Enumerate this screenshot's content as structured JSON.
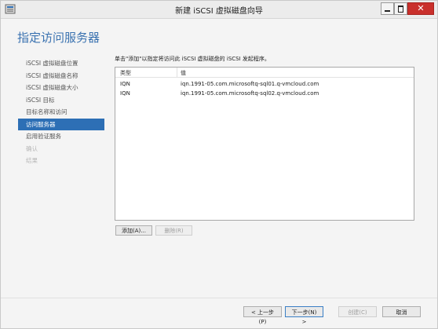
{
  "window": {
    "title": "新建 iSCSI 虚拟磁盘向导",
    "close_symbol": "✕"
  },
  "page_title": "指定访问服务器",
  "sidebar": {
    "items": [
      {
        "label": "iSCSI 虚拟磁盘位置",
        "state": "normal"
      },
      {
        "label": "iSCSI 虚拟磁盘名称",
        "state": "normal"
      },
      {
        "label": "iSCSI 虚拟磁盘大小",
        "state": "normal"
      },
      {
        "label": "iSCSI 目标",
        "state": "normal"
      },
      {
        "label": "目标名称和访问",
        "state": "normal"
      },
      {
        "label": "访问服务器",
        "state": "active"
      },
      {
        "label": "启用验证服务",
        "state": "normal"
      },
      {
        "label": "确认",
        "state": "disabled"
      },
      {
        "label": "结果",
        "state": "disabled"
      }
    ]
  },
  "main": {
    "instruction": "单击\"添加\"以指定将访问此 iSCSI 虚拟磁盘的 iSCSI 发起程序。",
    "columns": {
      "type": "类型",
      "value": "值"
    },
    "rows": [
      {
        "type": "IQN",
        "value": "iqn.1991-05.com.microsoftq-sql01.q-vmcloud.com"
      },
      {
        "type": "IQN",
        "value": "iqn.1991-05.com.microsoftq-sql02.q-vmcloud.com"
      }
    ],
    "add_label": "添加(A)...",
    "remove_label": "删除(R)"
  },
  "footer": {
    "prev_label": "< 上一步(P)",
    "next_label": "下一步(N) >",
    "create_label": "创建(C)",
    "cancel_label": "取消"
  },
  "colors": {
    "accent": "#2d6fb5",
    "title_blue": "#3a72b0",
    "close_red": "#c9302c"
  }
}
